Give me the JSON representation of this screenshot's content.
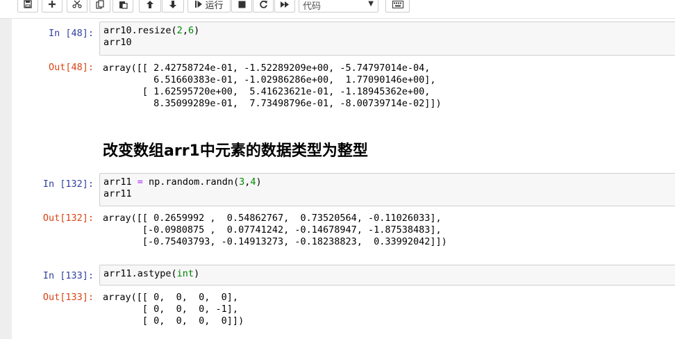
{
  "toolbar": {
    "run_label": "运行",
    "cell_type": "代码",
    "buttons": [
      {
        "name": "save-icon"
      },
      {
        "name": "add-icon"
      },
      {
        "name": "cut-icon"
      },
      {
        "name": "copy-icon"
      },
      {
        "name": "paste-icon"
      },
      {
        "name": "arrow-up-icon"
      },
      {
        "name": "arrow-down-icon"
      },
      {
        "name": "run-icon"
      },
      {
        "name": "stop-icon"
      },
      {
        "name": "restart-icon"
      },
      {
        "name": "fast-forward-icon"
      },
      {
        "name": "keyboard-icon"
      }
    ]
  },
  "cells": {
    "c48": {
      "in_prompt": "In [48]:",
      "line1": {
        "a": "arr10.resize(",
        "n1": "2",
        ",": ",",
        "n2": "6",
        ")": ")"
      },
      "line2": "arr10",
      "out_prompt": "Out[48]:",
      "output": "array([[ 2.42758724e-01, -1.52289209e+00, -5.74797014e-04,\n         6.51660383e-01, -1.02986286e+00,  1.77090146e+00],\n       [ 1.62595720e+00,  5.41623621e-01, -1.18945362e+00,\n         8.35099289e-01,  7.73498796e-01, -8.00739714e-02]])"
    },
    "heading": "改变数组arr1中元素的数据类型为整型",
    "c132": {
      "in_prompt": "In [132]:",
      "line1": {
        "a": "arr11 ",
        "op": "=",
        "b": " np.random.randn(",
        "n1": "3",
        ",": ",",
        "n2": "4",
        ")": ")"
      },
      "line2": "arr11",
      "out_prompt": "Out[132]:",
      "output": "array([[ 0.2659992 ,  0.54862767,  0.73520564, -0.11026033],\n       [-0.0980875 ,  0.07741242, -0.14678947, -1.87538483],\n       [-0.75403793, -0.14913273, -0.18238823,  0.33992042]])"
    },
    "c133": {
      "in_prompt": "In [133]:",
      "line1": {
        "a": "arr11.astype(",
        "builtin": "int",
        ")": ")"
      },
      "out_prompt": "Out[133]:",
      "output": "array([[ 0,  0,  0,  0],\n       [ 0,  0,  0, -1],\n       [ 0,  0,  0,  0]])"
    }
  }
}
